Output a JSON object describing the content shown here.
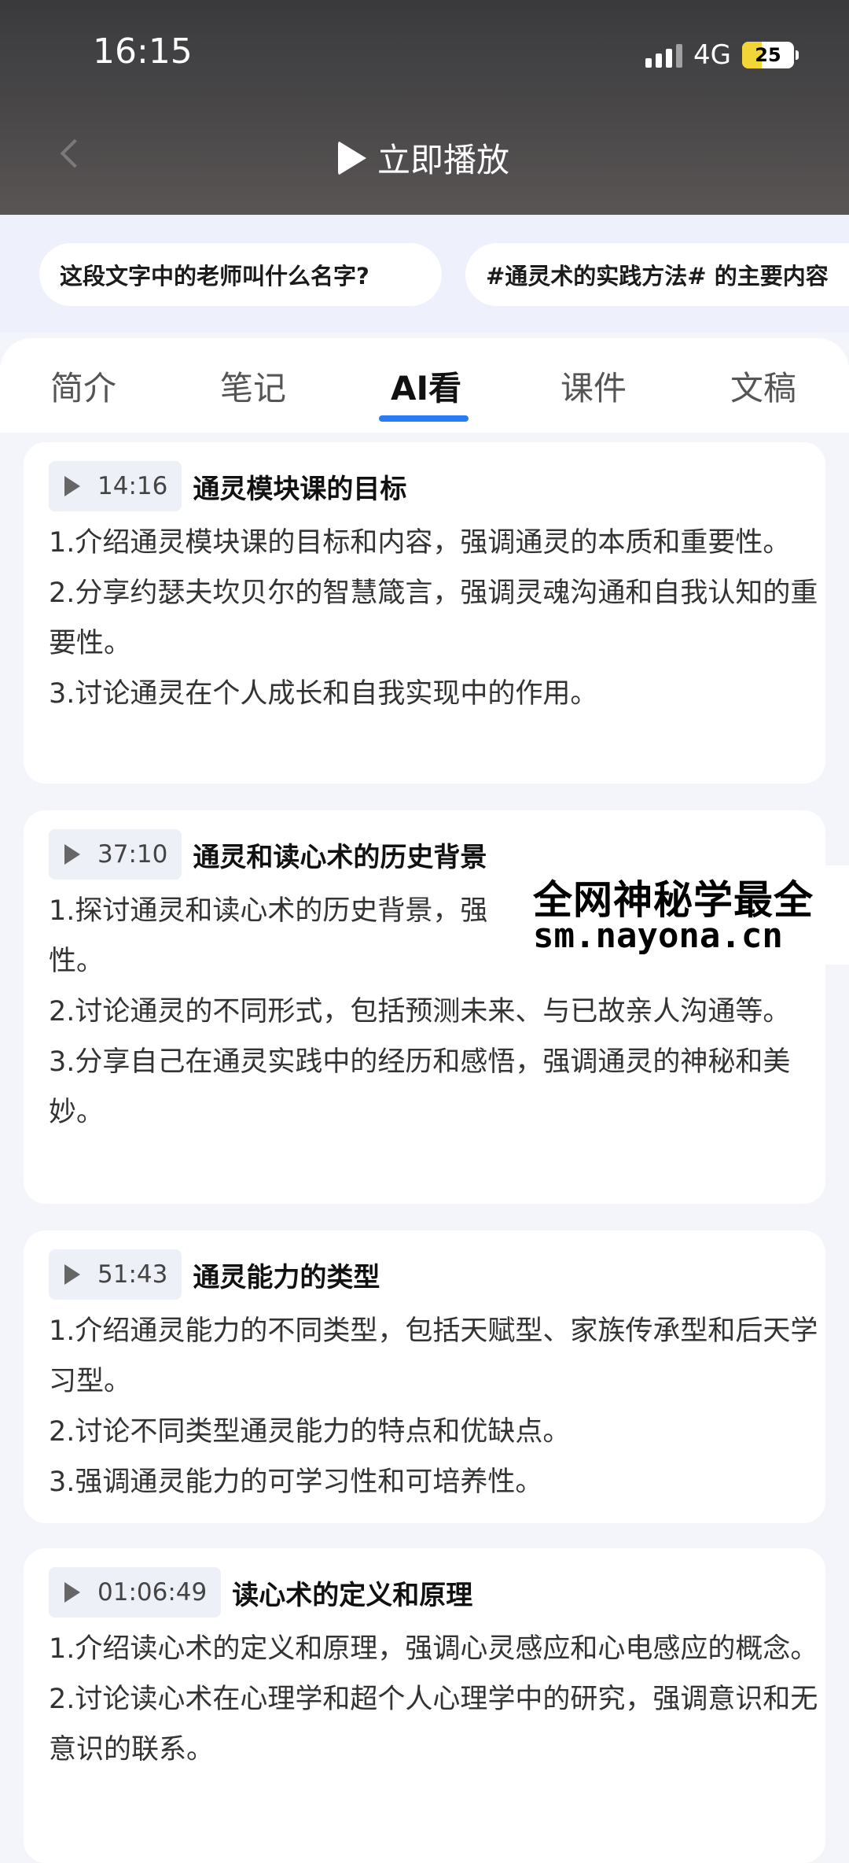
{
  "status_bar": {
    "time": "16:15",
    "network": "4G",
    "battery": "25"
  },
  "header": {
    "play_label": "立即播放"
  },
  "suggestions": [
    "这段文字中的老师叫什么名字?",
    "#通灵术的实践方法# 的主要内容"
  ],
  "tabs": [
    "简介",
    "笔记",
    "AI看",
    "课件",
    "文稿"
  ],
  "active_tab": "AI看",
  "accent_color": "#2a7cf6",
  "sections": [
    {
      "time": "14:16",
      "title": "通灵模块课的目标",
      "points": [
        "1.介绍通灵模块课的目标和内容，强调通灵的本质和重要性。",
        "2.分享约瑟夫坎贝尔的智慧箴言，强调灵魂沟通和自我认知的重要性。",
        "3.讨论通灵在个人成长和自我实现中的作用。"
      ]
    },
    {
      "time": "37:10",
      "title": "通灵和读心术的历史背景",
      "points": [
        "1.探讨通灵和读心术的历史背景，强",
        "性。",
        "2.讨论通灵的不同形式，包括预测未来、与已故亲人沟通等。",
        "3.分享自己在通灵实践中的经历和感悟，强调通灵的神秘和美妙。"
      ]
    },
    {
      "time": "51:43",
      "title": "通灵能力的类型",
      "points": [
        "1.介绍通灵能力的不同类型，包括天赋型、家族传承型和后天学习型。",
        "2.讨论不同类型通灵能力的特点和优缺点。",
        "3.强调通灵能力的可学习性和可培养性。"
      ]
    },
    {
      "time": "01:06:49",
      "title": "读心术的定义和原理",
      "points": [
        "1.介绍读心术的定义和原理，强调心灵感应和心电感应的概念。",
        "2.讨论读心术在心理学和超个人心理学中的研究，强调意识和无意识的联系。"
      ]
    }
  ],
  "watermark": {
    "line1": "全网神秘学最全",
    "line2": "sm.nayona.cn"
  }
}
